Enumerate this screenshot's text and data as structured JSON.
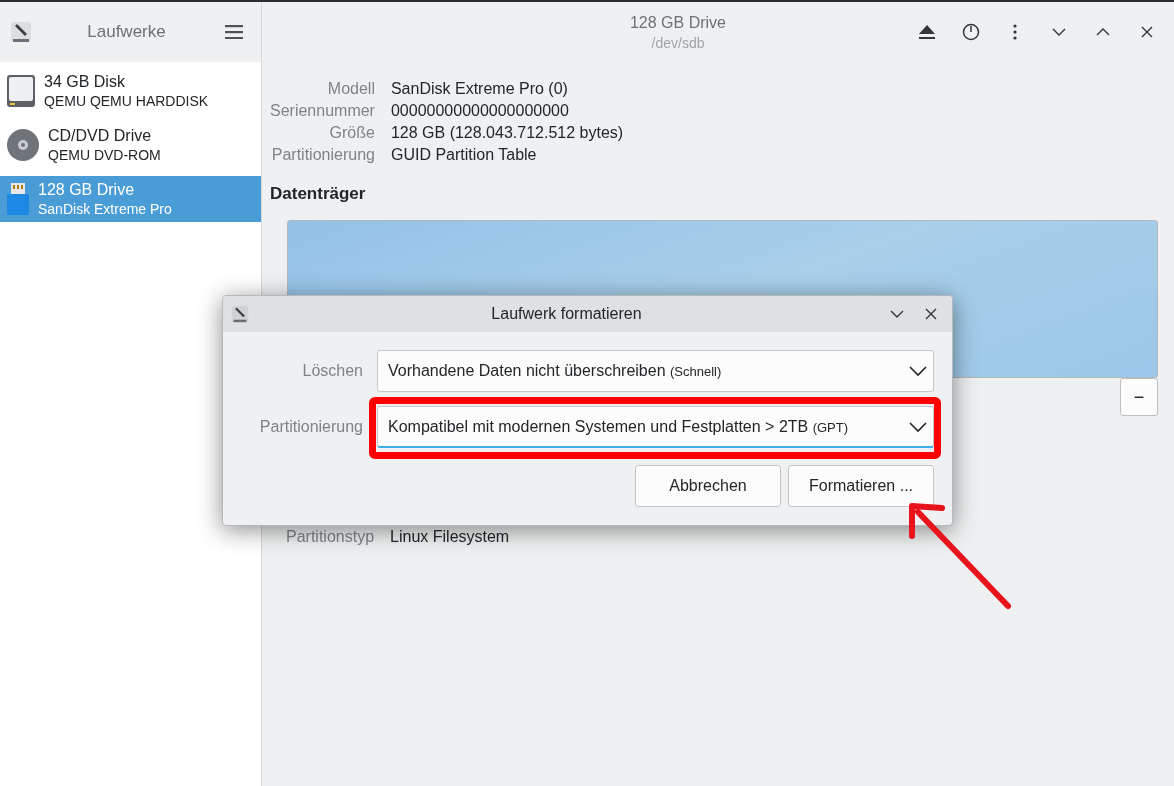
{
  "sidebar": {
    "title": "Laufwerke",
    "items": [
      {
        "kind": "disk",
        "name": "34 GB Disk",
        "model": "QEMU QEMU HARDDISK",
        "selected": false
      },
      {
        "kind": "optical",
        "name": "CD/DVD Drive",
        "model": "QEMU DVD-ROM",
        "selected": false
      },
      {
        "kind": "usb",
        "name": "128 GB Drive",
        "model": "SanDisk Extreme Pro",
        "selected": true
      }
    ]
  },
  "header": {
    "title": "128 GB Drive",
    "subtitle": "/dev/sdb"
  },
  "drive_info": [
    {
      "label": "Modell",
      "value": "SanDisk Extreme Pro (0)"
    },
    {
      "label": "Seriennummer",
      "value": "00000000000000000000"
    },
    {
      "label": "Größe",
      "value": "128 GB (128.043.712.512 bytes)"
    },
    {
      "label": "Partitionierung",
      "value": "GUID Partition Table"
    }
  ],
  "volumes_heading": "Datenträger",
  "volume_button": "−",
  "partition_info": [
    {
      "label": "Partitionstyp",
      "value": "Linux Filesystem"
    }
  ],
  "dialog": {
    "title": "Laufwerk formatieren",
    "fields": [
      {
        "label": "Löschen",
        "value": "Vorhandene Daten nicht überschreiben",
        "note": "(Schnell)",
        "focused": false
      },
      {
        "label": "Partitionierung",
        "value": "Kompatibel mit modernen Systemen und Festplatten > 2TB",
        "note": "(GPT)",
        "focused": true
      }
    ],
    "buttons": [
      "Abbrechen",
      "Formatieren ..."
    ]
  },
  "annotations": {
    "highlight_box": true,
    "pointer_arrow": true
  }
}
